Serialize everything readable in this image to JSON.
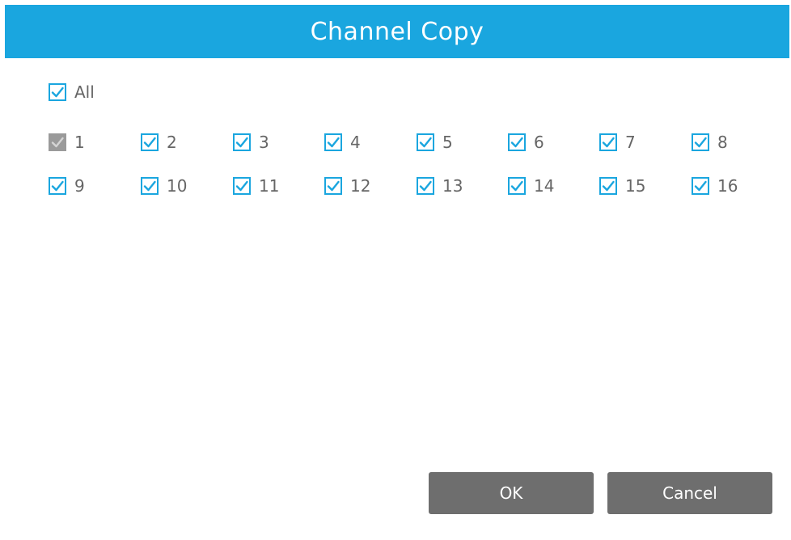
{
  "dialog": {
    "title": "Channel Copy",
    "accent_color": "#1aa6df",
    "disabled_color": "#9a9a9a",
    "button_color": "#6e6e6e"
  },
  "select_all": {
    "label": "All",
    "checked": true
  },
  "channels": [
    {
      "label": "1",
      "checked": true,
      "disabled": true
    },
    {
      "label": "2",
      "checked": true,
      "disabled": false
    },
    {
      "label": "3",
      "checked": true,
      "disabled": false
    },
    {
      "label": "4",
      "checked": true,
      "disabled": false
    },
    {
      "label": "5",
      "checked": true,
      "disabled": false
    },
    {
      "label": "6",
      "checked": true,
      "disabled": false
    },
    {
      "label": "7",
      "checked": true,
      "disabled": false
    },
    {
      "label": "8",
      "checked": true,
      "disabled": false
    },
    {
      "label": "9",
      "checked": true,
      "disabled": false
    },
    {
      "label": "10",
      "checked": true,
      "disabled": false
    },
    {
      "label": "11",
      "checked": true,
      "disabled": false
    },
    {
      "label": "12",
      "checked": true,
      "disabled": false
    },
    {
      "label": "13",
      "checked": true,
      "disabled": false
    },
    {
      "label": "14",
      "checked": true,
      "disabled": false
    },
    {
      "label": "15",
      "checked": true,
      "disabled": false
    },
    {
      "label": "16",
      "checked": true,
      "disabled": false
    }
  ],
  "buttons": {
    "ok_label": "OK",
    "cancel_label": "Cancel"
  }
}
